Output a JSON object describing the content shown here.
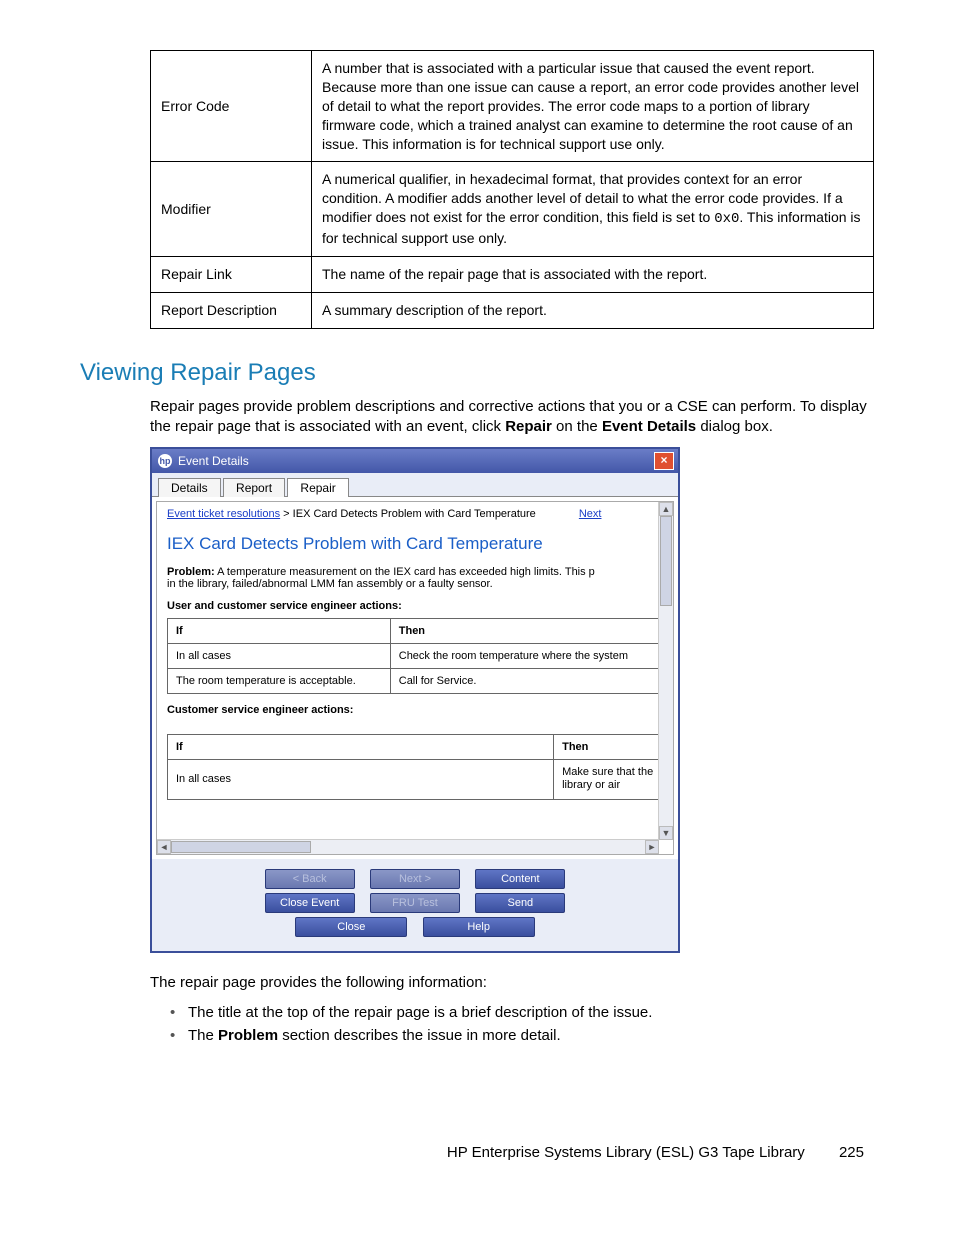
{
  "def_table": {
    "rows": [
      {
        "term": "Error Code",
        "desc": "A number that is associated with a particular issue that caused the event report. Because more than one issue can cause a report, an error code provides another level of detail to what the report provides. The error code maps to a portion of library firmware code, which a trained analyst can examine to determine the root cause of an issue. This information is for technical support use only."
      },
      {
        "term": "Modifier",
        "desc_pre": "A numerical qualifier, in hexadecimal format, that provides context for an error condition. A modifier adds another level of detail to what the error code provides. If a modifier does not exist for the error condition, this field is set to ",
        "code": "0x0",
        "desc_post": ". This information is for technical support use only."
      },
      {
        "term": "Repair Link",
        "desc": "The name of the repair page that is associated with the report."
      },
      {
        "term": "Report Description",
        "desc": "A summary description of the report."
      }
    ]
  },
  "section_title": "Viewing Repair Pages",
  "intro_pre": "Repair pages provide problem descriptions and corrective actions that you or a CSE can perform. To display the repair page that is associated with an event, click ",
  "intro_b1": "Repair",
  "intro_mid": " on the ",
  "intro_b2": "Event Details",
  "intro_post": " dialog box.",
  "dialog": {
    "title": "Event Details",
    "tabs": [
      "Details",
      "Report",
      "Repair"
    ],
    "breadcrumb_link": "Event ticket resolutions",
    "breadcrumb_sep": " > ",
    "breadcrumb_current": "IEX Card Detects Problem with Card Temperature",
    "breadcrumb_next": "Next",
    "repair_title": "IEX Card Detects Problem with Card Temperature",
    "problem_label": "Problem:",
    "problem_text": " A temperature measurement on the IEX card has exceeded high limits. This p",
    "problem_line2": "in the library, failed/abnormal LMM fan assembly or a faulty sensor.",
    "subhead1": "User and customer service engineer actions:",
    "table1": {
      "h1": "If",
      "h2": "Then",
      "rows": [
        {
          "c1": "In all cases",
          "c2": "Check the room temperature where the system"
        },
        {
          "c1": "The room temperature is acceptable.",
          "c2": "Call for Service."
        }
      ]
    },
    "subhead2": "Customer service engineer actions:",
    "table2": {
      "h1": "If",
      "h2": "Then",
      "rows": [
        {
          "c1": "In all cases",
          "c2": "Make sure that the library or air"
        }
      ]
    },
    "nav_back": "< Back",
    "nav_next": "Next >",
    "nav_content": "Content",
    "btn_close_event": "Close Event",
    "btn_fru": "FRU Test",
    "btn_send": "Send",
    "btn_close": "Close",
    "btn_help": "Help"
  },
  "outro": "The repair page provides the following information:",
  "bullet1": "The title at the top of the repair page is a brief description of the issue.",
  "bullet2_pre": "The ",
  "bullet2_b": "Problem",
  "bullet2_post": " section describes the issue in more detail.",
  "footer_text": "HP Enterprise Systems Library (ESL) G3 Tape Library",
  "page_num": "225"
}
